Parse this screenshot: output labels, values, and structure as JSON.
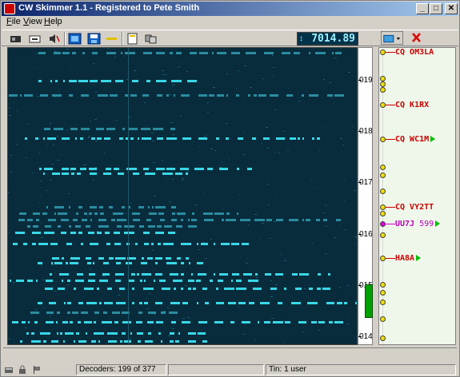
{
  "window": {
    "title": "CW Skimmer 1.1 - Registered to Pete Smith",
    "controls": [
      "_",
      "□",
      "✕"
    ]
  },
  "menu": {
    "items": [
      {
        "first": "F",
        "rest": "ile"
      },
      {
        "first": "V",
        "rest": "iew"
      },
      {
        "first": "H",
        "rest": "elp"
      }
    ]
  },
  "toolbar": {
    "frequency": "7014.89",
    "freq_icon": "↕"
  },
  "scale": {
    "labels": [
      "019",
      "018",
      "017",
      "016",
      "015",
      "014"
    ]
  },
  "spots": [
    {
      "call": "CQ OM3LA",
      "rst": "",
      "arrow": false,
      "color": "red"
    },
    {
      "call": "CQ K1RX",
      "rst": "",
      "arrow": false,
      "color": "red"
    },
    {
      "call": "CQ WC1M",
      "rst": "",
      "arrow": true,
      "color": "red"
    },
    {
      "call": "CQ VY2TT",
      "rst": "",
      "arrow": false,
      "color": "red"
    },
    {
      "call": "UU7J",
      "rst": "599",
      "arrow": true,
      "color": "magenta"
    },
    {
      "call": "HA8A",
      "rst": "",
      "arrow": true,
      "color": "red"
    }
  ],
  "statusbar": {
    "decoders": "Decoders: 199 of 377",
    "tin": "Tin: 1 user"
  },
  "colors": {
    "waterfall_bg": "#082c3c",
    "signal": "#38d8e8",
    "spot_red": "#cc0000",
    "spot_magenta": "#c000c0"
  }
}
